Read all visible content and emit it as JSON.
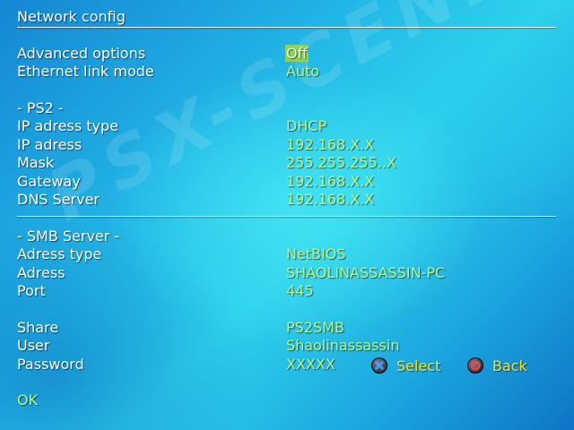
{
  "watermark": "PSX-SCENE",
  "title": "Network config",
  "rows": [
    {
      "label": "Advanced options",
      "value": "Off"
    },
    {
      "label": "Ethernet link mode",
      "value": "Auto"
    },
    {
      "label": "- PS2 -",
      "value": ""
    },
    {
      "label": "IP adress type",
      "value": "DHCP"
    },
    {
      "label": "IP adress",
      "value": "192.168.X.X"
    },
    {
      "label": "Mask",
      "value": "255.255.255..X"
    },
    {
      "label": "Gateway",
      "value": "192.168.X.X"
    },
    {
      "label": "DNS Server",
      "value": "192.168.X.X"
    },
    {
      "label": "- SMB Server -",
      "value": ""
    },
    {
      "label": "Adress type",
      "value": "NetBIOS"
    },
    {
      "label": "Adress",
      "value": "SHAOLINASSASSIN-PC"
    },
    {
      "label": "Port",
      "value": "445"
    },
    {
      "label": "Share",
      "value": "PS2SMB"
    },
    {
      "label": "User",
      "value": "Shaolinassassin"
    },
    {
      "label": "Password",
      "value": "XXXXX"
    }
  ],
  "ok_label": "OK",
  "hints": [
    {
      "icon": "cross-button-icon",
      "label": "Select"
    },
    {
      "icon": "circle-button-icon",
      "label": "Back"
    }
  ],
  "colors": {
    "label": "#ffffff",
    "value": "#b8f38a",
    "selected_bg": "#8ad45e",
    "hint": "#ffe01a",
    "cross": "#2f6fd6",
    "circle": "#e2322f"
  }
}
